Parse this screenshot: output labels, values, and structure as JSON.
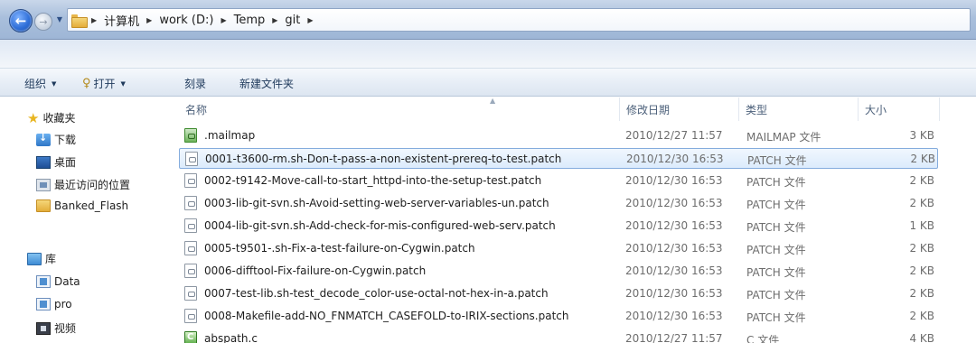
{
  "breadcrumb": [
    "计算机",
    "work (D:)",
    "Temp",
    "git"
  ],
  "toolbar": {
    "organize": "组织",
    "open": "打开",
    "burn": "刻录",
    "new_folder": "新建文件夹"
  },
  "nav": {
    "favorites": "收藏夹",
    "favorites_items": [
      "下载",
      "桌面",
      "最近访问的位置",
      "Banked_Flash"
    ],
    "libraries": "库",
    "library_items": [
      "Data",
      "pro",
      "视频"
    ]
  },
  "columns": {
    "name": "名称",
    "date": "修改日期",
    "type": "类型",
    "size": "大小"
  },
  "files": [
    {
      "name": ".mailmap",
      "date": "2010/12/27 11:57",
      "type": "MAILMAP 文件",
      "size": "3 KB",
      "icon": "git-file-icon"
    },
    {
      "name": "0001-t3600-rm.sh-Don-t-pass-a-non-existent-prereq-to-test.patch",
      "date": "2010/12/30 16:53",
      "type": "PATCH 文件",
      "size": "2 KB",
      "icon": "patch-file-icon"
    },
    {
      "name": "0002-t9142-Move-call-to-start_httpd-into-the-setup-test.patch",
      "date": "2010/12/30 16:53",
      "type": "PATCH 文件",
      "size": "2 KB",
      "icon": "patch-file-icon"
    },
    {
      "name": "0003-lib-git-svn.sh-Avoid-setting-web-server-variables-un.patch",
      "date": "2010/12/30 16:53",
      "type": "PATCH 文件",
      "size": "2 KB",
      "icon": "patch-file-icon"
    },
    {
      "name": "0004-lib-git-svn.sh-Add-check-for-mis-configured-web-serv.patch",
      "date": "2010/12/30 16:53",
      "type": "PATCH 文件",
      "size": "1 KB",
      "icon": "patch-file-icon"
    },
    {
      "name": "0005-t9501-.sh-Fix-a-test-failure-on-Cygwin.patch",
      "date": "2010/12/30 16:53",
      "type": "PATCH 文件",
      "size": "2 KB",
      "icon": "patch-file-icon"
    },
    {
      "name": "0006-difftool-Fix-failure-on-Cygwin.patch",
      "date": "2010/12/30 16:53",
      "type": "PATCH 文件",
      "size": "2 KB",
      "icon": "patch-file-icon"
    },
    {
      "name": "0007-test-lib.sh-test_decode_color-use-octal-not-hex-in-a.patch",
      "date": "2010/12/30 16:53",
      "type": "PATCH 文件",
      "size": "2 KB",
      "icon": "patch-file-icon"
    },
    {
      "name": "0008-Makefile-add-NO_FNMATCH_CASEFOLD-to-IRIX-sections.patch",
      "date": "2010/12/30 16:53",
      "type": "PATCH 文件",
      "size": "2 KB",
      "icon": "patch-file-icon"
    },
    {
      "name": "abspath.c",
      "date": "2010/12/27 11:57",
      "type": "C 文件",
      "size": "4 KB",
      "icon": "c-source-file-icon"
    }
  ],
  "selected_index": 1
}
